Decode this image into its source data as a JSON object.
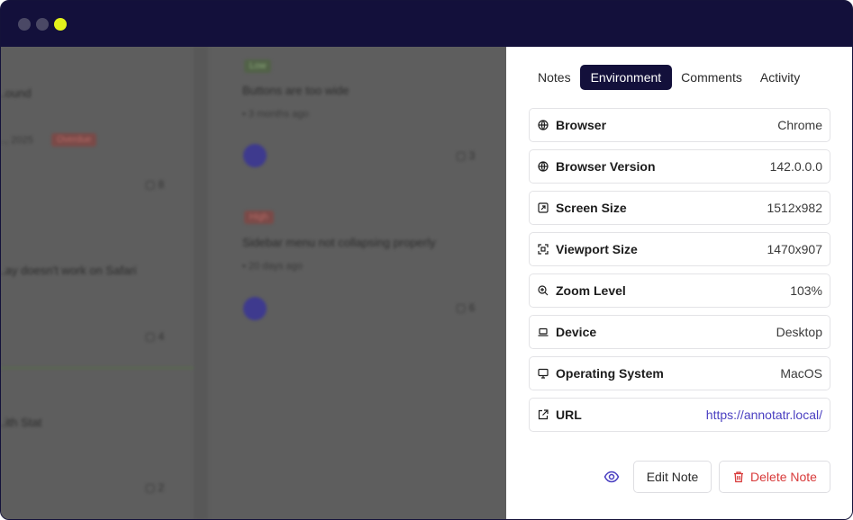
{
  "window": {
    "controls": {
      "close_color": "#4a4865",
      "minimize_color": "#4a4865",
      "maximize_color": "#e3f21b"
    }
  },
  "background": {
    "left_column": {
      "cards": [
        {
          "title": "...ound",
          "meta": "..., 2025",
          "badge": "Overdue",
          "comments": "8"
        },
        {
          "title": "...ay doesn't work on Safari",
          "meta": "",
          "comments": "4"
        },
        {
          "title": "...ith Stat",
          "meta": "",
          "comments": "2"
        }
      ]
    },
    "middle_column": {
      "cards": [
        {
          "badge": "Low",
          "title": "Buttons are too wide",
          "meta": "3 months ago",
          "comments": "3"
        },
        {
          "badge": "High",
          "title": "Sidebar menu not collapsing properly",
          "meta": "20 days ago",
          "comments": "6"
        }
      ]
    }
  },
  "panel": {
    "tabs": [
      {
        "label": "Notes",
        "active": false
      },
      {
        "label": "Environment",
        "active": true
      },
      {
        "label": "Comments",
        "active": false
      },
      {
        "label": "Activity",
        "active": false
      }
    ],
    "environment": [
      {
        "icon": "globe-icon",
        "label": "Browser",
        "value": "Chrome"
      },
      {
        "icon": "globe-icon",
        "label": "Browser Version",
        "value": "142.0.0.0"
      },
      {
        "icon": "resize-icon",
        "label": "Screen Size",
        "value": "1512x982"
      },
      {
        "icon": "scan-icon",
        "label": "Viewport Size",
        "value": "1470x907"
      },
      {
        "icon": "zoom-in-icon",
        "label": "Zoom Level",
        "value": "103%"
      },
      {
        "icon": "laptop-icon",
        "label": "Device",
        "value": "Desktop"
      },
      {
        "icon": "monitor-icon",
        "label": "Operating System",
        "value": "MacOS"
      },
      {
        "icon": "external-link-icon",
        "label": "URL",
        "value": "https://annotatr.local/"
      }
    ],
    "actions": {
      "edit_label": "Edit Note",
      "delete_label": "Delete Note"
    }
  },
  "colors": {
    "accent": "#13103b",
    "link": "#4a3fc1",
    "danger": "#d83a3a",
    "eye": "#4a3fc1"
  }
}
